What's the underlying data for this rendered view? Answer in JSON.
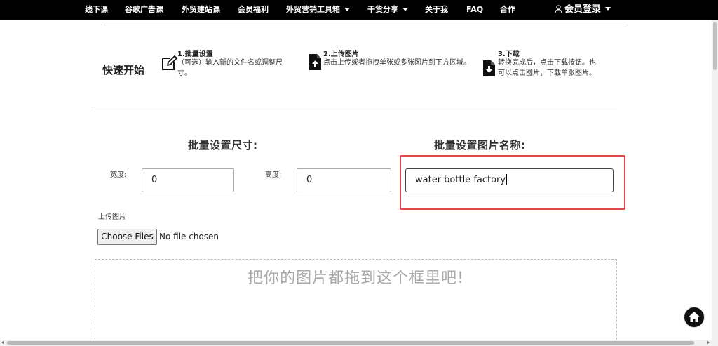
{
  "nav": {
    "items": [
      {
        "label": "线下课"
      },
      {
        "label": "谷歌广告课"
      },
      {
        "label": "外贸建站课"
      },
      {
        "label": "会员福利"
      },
      {
        "label": "外贸营销工具箱"
      },
      {
        "label": "干货分享"
      },
      {
        "label": "关于我"
      },
      {
        "label": "FAQ"
      },
      {
        "label": "合作"
      }
    ],
    "login": "会员登录"
  },
  "quickstart": {
    "title": "快速开始",
    "steps": [
      {
        "title": "1.批量设置",
        "desc": "（可选）输入新的文件名或调整尺寸。",
        "icon": "edit-icon"
      },
      {
        "title": "2.上传图片",
        "desc": "点击上传或者拖拽单张或多张图片到下方区域。",
        "icon": "upload-file-icon"
      },
      {
        "title": "3.下载",
        "desc": "转换完成后，点击下载按钮。也可以点击图片，下载单张图片。",
        "icon": "download-file-icon"
      }
    ]
  },
  "settings": {
    "size_title": "批量设置尺寸:",
    "name_title": "批量设置图片名称:",
    "width_label": "宽度:",
    "width_value": "0",
    "height_label": "高度:",
    "height_value": "0",
    "name_value": "water bottle factory"
  },
  "upload": {
    "label": "上传图片",
    "button": "Choose Files",
    "status": "No file chosen",
    "dropzone_text": "把你的图片都拖到这个框里吧!"
  },
  "colors": {
    "nav_bg": "#000000",
    "highlight": "#e04848"
  }
}
